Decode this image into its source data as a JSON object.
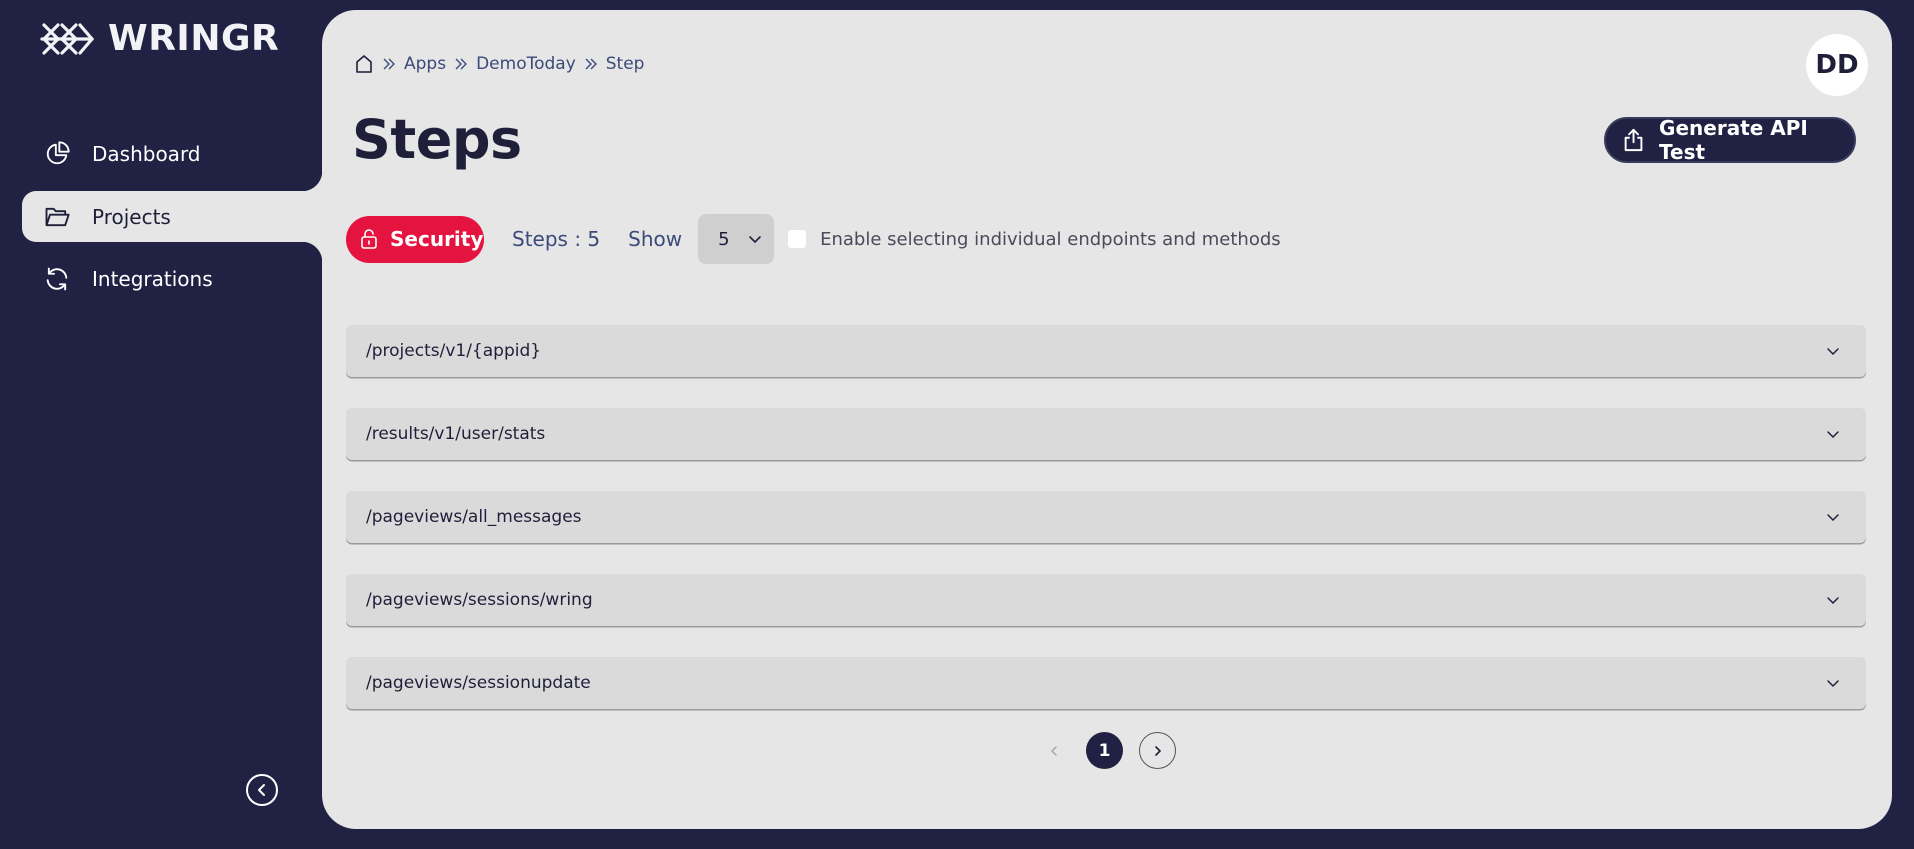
{
  "app": {
    "name": "WRINGR"
  },
  "sidebar": {
    "items": [
      {
        "label": "Dashboard",
        "icon": "pie-chart-icon",
        "active": false
      },
      {
        "label": "Projects",
        "icon": "folder-open-icon",
        "active": true
      },
      {
        "label": "Integrations",
        "icon": "refresh-icon",
        "active": false
      }
    ],
    "collapse_icon": "chevron-left-circle-icon"
  },
  "breadcrumb": [
    "Apps",
    "DemoToday",
    "Step"
  ],
  "avatar": {
    "initials": "DD"
  },
  "page": {
    "title": "Steps"
  },
  "actions": {
    "generate_label": "Generate API Test"
  },
  "toolbar": {
    "security_label": "Security",
    "steps_count": "Steps : 5",
    "show_label": "Show",
    "show_value": "5",
    "checkbox_label": "Enable selecting individual endpoints and methods",
    "checkbox_checked": false
  },
  "endpoints": [
    "/projects/v1/{appid}",
    "/results/v1/user/stats",
    "/pageviews/all_messages",
    "/pageviews/sessions/wring",
    "/pageviews/sessionupdate"
  ],
  "pagination": {
    "current": "1"
  },
  "colors": {
    "sidebar_bg": "#212143",
    "panel_bg": "#e6e6e6",
    "accent_red": "#e5133f"
  }
}
